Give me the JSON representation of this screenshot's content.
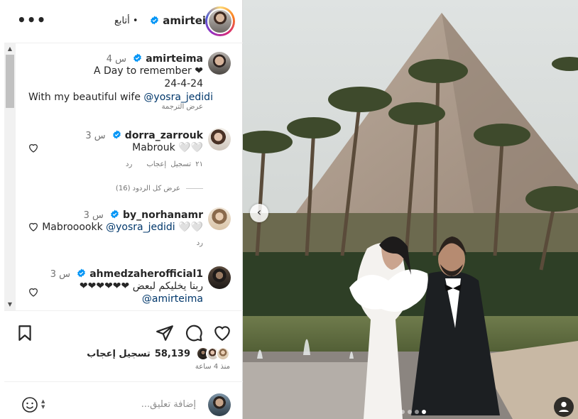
{
  "header": {
    "username": "amirteima",
    "follow_label": "• أتابع",
    "more_label": "•••"
  },
  "caption": {
    "username": "amirteima",
    "time": "4 س",
    "line1": "A Day to remember ❤",
    "line2": "24-4-24",
    "line3_prefix": "With my beautiful wife ",
    "mention": "@yosra_jedidi",
    "translate": "عرض الترجمة"
  },
  "comments": [
    {
      "username": "dorra_zarrouk",
      "time": "3 س",
      "text": "Mabrouk 🤍🤍",
      "likes": "٢١ تسجيل إعجاب",
      "reply": "رد",
      "view_replies": "عرض كل الردود (16)"
    },
    {
      "username": "by_norhanamr",
      "time": "3 س",
      "text_prefix": "Mabrooookk ",
      "mention": "@yosra_jedidi",
      "text_suffix": " 🤍🤍",
      "reply": "رد"
    },
    {
      "username": "ahmedzaherofficial1",
      "time": "3 س",
      "text": "ربنا يخليكم لبعض ❤❤❤❤❤❤",
      "mention": "@amirteima"
    }
  ],
  "actions": {
    "likes_count": "58,139",
    "likes_label": "تسجيل إعجاب",
    "time_ago": "منذ 4 ساعة"
  },
  "comment_box": {
    "placeholder": "إضافة تعليق..."
  },
  "carousel": {
    "total": 4,
    "active_index": 3
  },
  "colors": {
    "verified": "#0095f6",
    "link": "#00376b",
    "muted": "#737373"
  }
}
